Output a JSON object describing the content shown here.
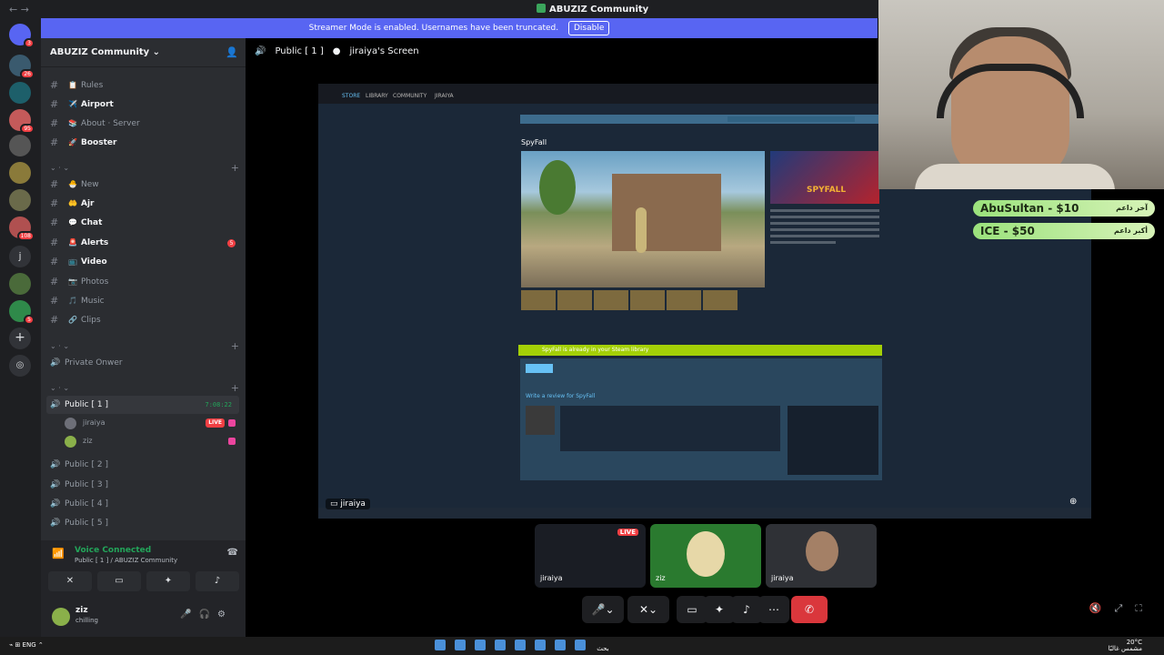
{
  "window": {
    "title": "ABUZIZ Community"
  },
  "banner": {
    "text": "Streamer Mode is enabled. Usernames have been truncated.",
    "disable_label": "Disable"
  },
  "servers": [
    {
      "badge": "3"
    },
    {
      "badge": "26"
    },
    {
      "badge": ""
    },
    {
      "badge": "95"
    },
    {
      "badge": ""
    },
    {
      "badge": ""
    },
    {
      "badge": ""
    },
    {
      "badge": "108"
    },
    {
      "badge": ""
    },
    {
      "badge": ""
    },
    {
      "badge": "5"
    }
  ],
  "server_letter": "j",
  "guild": {
    "name": "ABUZIZ Community"
  },
  "text_channels_top": [
    {
      "emoji": "📋",
      "label": "Rules",
      "bold": false
    },
    {
      "emoji": "✈️",
      "label": "Airport",
      "bold": true
    },
    {
      "emoji": "📚",
      "label": "About · Server",
      "bold": false
    },
    {
      "emoji": "🚀",
      "label": "Booster",
      "bold": true
    }
  ],
  "text_channels": [
    {
      "emoji": "🐣",
      "label": "New",
      "bold": false,
      "mention": ""
    },
    {
      "emoji": "🤲",
      "label": "Ajr",
      "bold": true,
      "mention": ""
    },
    {
      "emoji": "💬",
      "label": "Chat",
      "bold": true,
      "mention": ""
    },
    {
      "emoji": "🚨",
      "label": "Alerts",
      "bold": true,
      "mention": "5"
    },
    {
      "emoji": "📺",
      "label": "Video",
      "bold": true,
      "mention": ""
    },
    {
      "emoji": "📷",
      "label": "Photos",
      "bold": false,
      "mention": ""
    },
    {
      "emoji": "🎵",
      "label": "Music",
      "bold": false,
      "mention": ""
    },
    {
      "emoji": "🔗",
      "label": "Clips",
      "bold": false,
      "mention": ""
    }
  ],
  "private_channel": {
    "label": "Private Onwer"
  },
  "voice_active": {
    "label": "Public [ 1 ]",
    "timer": "7:08:22",
    "members": [
      {
        "name": "jiraiya",
        "live": "LIVE"
      },
      {
        "name": "ziz",
        "live": ""
      }
    ]
  },
  "voice_channels": [
    "Public [ 2 ]",
    "Public [ 3 ]",
    "Public [ 4 ]",
    "Public [ 5 ]"
  ],
  "voice_panel": {
    "title": "Voice Connected",
    "subtitle": "Public [ 1 ] / ABUZIZ Community"
  },
  "user": {
    "name": "ziz",
    "status": "chilling"
  },
  "stage": {
    "channel": "Public [ 1 ]",
    "screen": "jiraiya's Screen",
    "sharer": "jiraiya"
  },
  "steam": {
    "tabs": [
      "STORE",
      "LIBRARY",
      "COMMUNITY",
      "JIRAIYA"
    ],
    "game_title": "SpyFall",
    "capsule": "SPYFALL",
    "in_library": "SpyFall is already in your Steam library",
    "review_heading": "Write a review for SpyFall"
  },
  "donors": [
    {
      "text": "AbuSultan - $10",
      "arabic": "آخر داعم"
    },
    {
      "text": "ICE - $50",
      "arabic": "أكبر داعم"
    }
  ],
  "tiles": [
    {
      "label": "jiraiya",
      "live": "LIVE"
    },
    {
      "label": "ziz",
      "live": ""
    },
    {
      "label": "jiraiya",
      "live": ""
    }
  ],
  "taskbar": {
    "lang": "ENG",
    "search": "بحث",
    "weather": "20°C",
    "weather_sub": "مشمس غالبًا"
  }
}
